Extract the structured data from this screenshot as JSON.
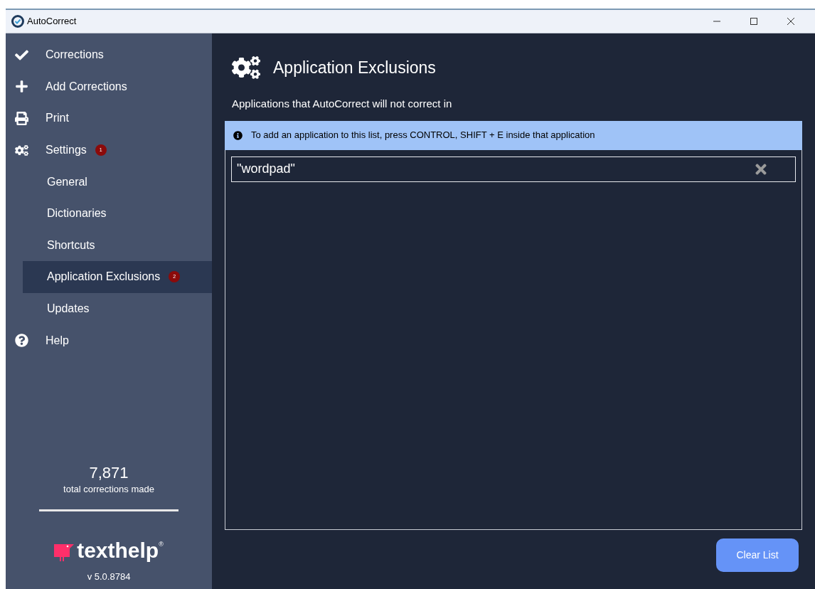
{
  "window": {
    "title": "AutoCorrect"
  },
  "sidebar": {
    "items": [
      {
        "label": "Corrections",
        "kind": "check",
        "selected": false
      },
      {
        "label": "Add Corrections",
        "kind": "plus",
        "selected": false
      },
      {
        "label": "Print",
        "kind": "print",
        "selected": false
      },
      {
        "label": "Settings",
        "kind": "gears",
        "selected": false,
        "badge": "1",
        "children": [
          {
            "label": "General",
            "selected": false
          },
          {
            "label": "Dictionaries",
            "selected": false
          },
          {
            "label": "Shortcuts",
            "selected": false
          },
          {
            "label": "Application Exclusions",
            "selected": true,
            "badge": "2"
          },
          {
            "label": "Updates",
            "selected": false
          }
        ]
      },
      {
        "label": "Help",
        "kind": "help",
        "selected": false
      }
    ],
    "stats": {
      "count": "7,871",
      "caption": "total corrections made"
    },
    "logo": {
      "name": "texthelp",
      "mark": "®"
    },
    "version": "v 5.0.8784"
  },
  "main": {
    "title": "Application Exclusions",
    "subtitle": "Applications that AutoCorrect will not correct in",
    "info": "To add an application to this list, press CONTROL, SHIFT + E inside that application",
    "entries": [
      "\"wordpad\""
    ],
    "button": "Clear List"
  }
}
